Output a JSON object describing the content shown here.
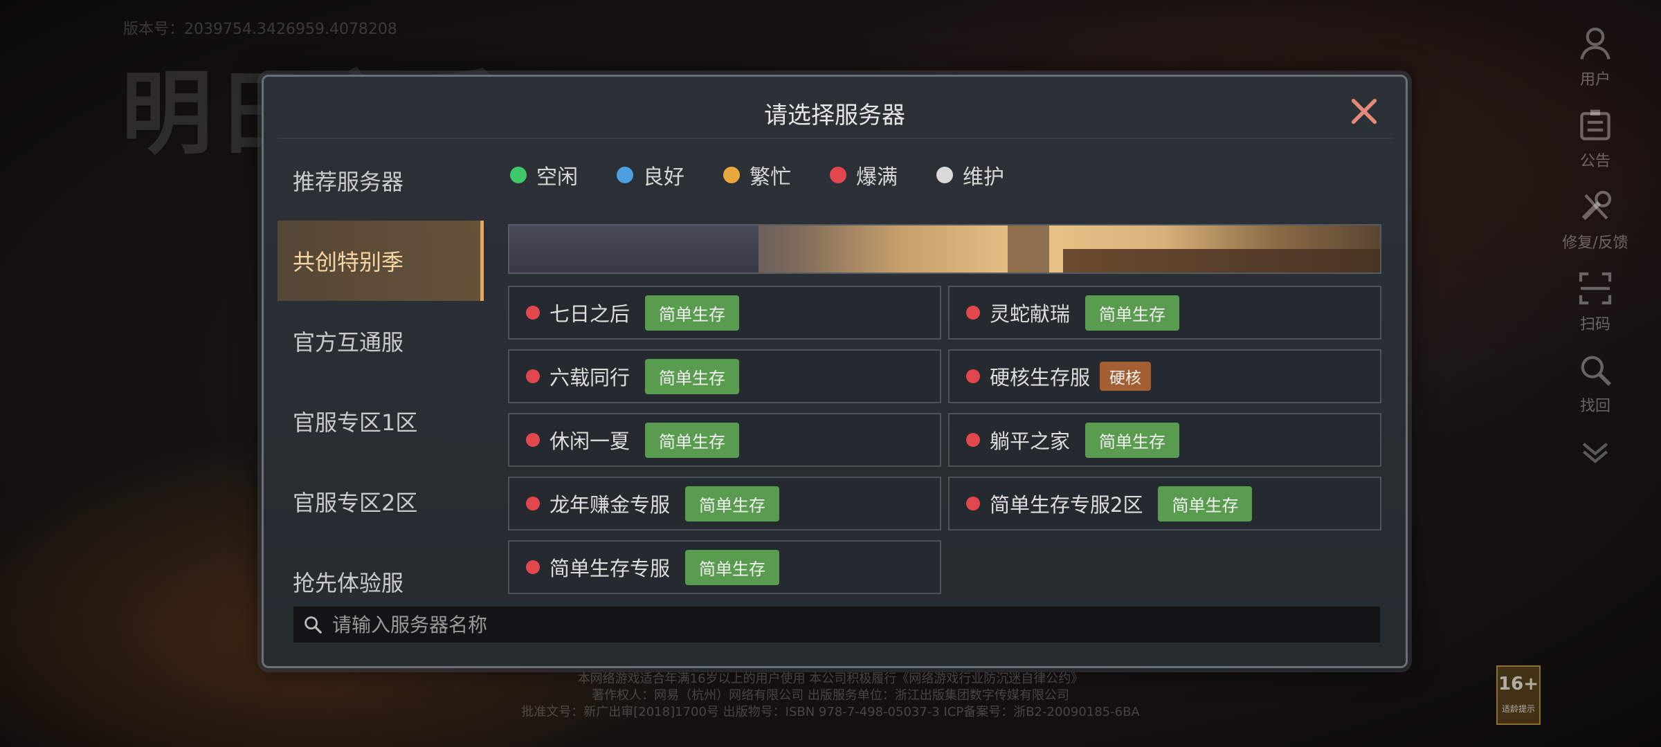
{
  "version": "版本号：2039754.3426959.4078208",
  "logo": "明日之后",
  "side_menu": [
    {
      "label": "用户",
      "icon": "user-icon"
    },
    {
      "label": "公告",
      "icon": "notice-icon"
    },
    {
      "label": "修复/反馈",
      "icon": "wrench-icon"
    },
    {
      "label": "扫码",
      "icon": "scan-icon"
    },
    {
      "label": "找回",
      "icon": "magnifier-icon"
    }
  ],
  "modal": {
    "title": "请选择服务器",
    "tabs": [
      "推荐服务器",
      "共创特别季",
      "官方互通服",
      "官服专区1区",
      "官服专区2区",
      "抢先体验服"
    ],
    "active_tab": "共创特别季",
    "legend": [
      {
        "label": "空闲",
        "color": "#3ec86a"
      },
      {
        "label": "良好",
        "color": "#4e9ee0"
      },
      {
        "label": "繁忙",
        "color": "#e8a93c"
      },
      {
        "label": "爆满",
        "color": "#e2474d"
      },
      {
        "label": "维护",
        "color": "#d9d9d9"
      }
    ],
    "servers": [
      {
        "name": "七日之后",
        "tag": "简单生存"
      },
      {
        "name": "灵蛇献瑞",
        "tag": "简单生存"
      },
      {
        "name": "六载同行",
        "tag": "简单生存"
      },
      {
        "name": "硬核生存服",
        "tag": "硬核"
      },
      {
        "name": "休闲一夏",
        "tag": "简单生存"
      },
      {
        "name": "躺平之家",
        "tag": "简单生存"
      },
      {
        "name": "龙年赚金专服",
        "tag": "简单生存"
      },
      {
        "name": "简单生存专服2区",
        "tag": "简单生存"
      },
      {
        "name": "简单生存专服",
        "tag": "简单生存"
      }
    ],
    "search_placeholder": "请输入服务器名称"
  },
  "footer": {
    "line1": "本网络游戏适合年满16岁以上的用户使用 本公司积极履行《网络游戏行业防沉迷自律公约》",
    "line2": "著作权人：网易（杭州）网络有限公司   出版服务单位：浙江出版集团数字传媒有限公司",
    "line3": "批准文号：新广出审[2018]1700号    出版物号：ISBN 978-7-498-05037-3    ICP备案号：浙B2-20090185-6BA"
  },
  "age_badge": "16+",
  "age_badge_sub": "适龄提示"
}
